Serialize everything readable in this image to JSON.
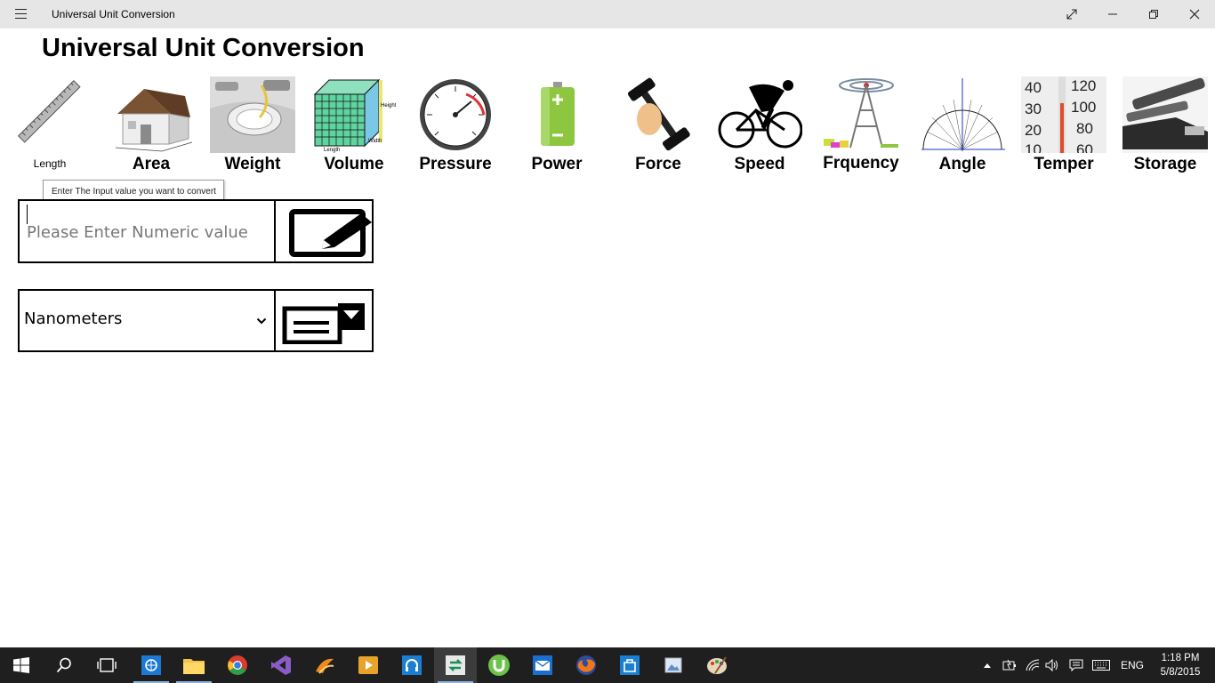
{
  "window": {
    "title": "Universal Unit Conversion",
    "menu_icon": "hamburger-menu-icon",
    "controls": [
      "fullscreen-icon",
      "minimize-icon",
      "restore-icon",
      "close-icon"
    ]
  },
  "page": {
    "title": "Universal Unit Conversion"
  },
  "categories": [
    {
      "label": "Length",
      "icon": "ruler-icon"
    },
    {
      "label": "Area",
      "icon": "house-icon"
    },
    {
      "label": "Weight",
      "icon": "scale-icon"
    },
    {
      "label": "Volume",
      "icon": "grid-cube-icon"
    },
    {
      "label": "Pressure",
      "icon": "pressure-gauge-icon"
    },
    {
      "label": "Power",
      "icon": "battery-icon"
    },
    {
      "label": "Force",
      "icon": "dumbbell-icon"
    },
    {
      "label": "Speed",
      "icon": "cyclist-icon"
    },
    {
      "label": "Frquency",
      "icon": "radio-tower-icon"
    },
    {
      "label": "Angle",
      "icon": "protractor-icon"
    },
    {
      "label": "Temper",
      "icon": "thermometer-icon"
    },
    {
      "label": "Storage",
      "icon": "usb-drive-icon"
    }
  ],
  "input": {
    "tooltip": "Enter The Input value you want to convert",
    "placeholder": "Please Enter Numeric value",
    "value": "",
    "edit_button_icon": "edit-pencil-icon"
  },
  "unit_select": {
    "selected": "Nanometers",
    "button_icon": "dropdown-list-icon"
  },
  "taskbar": {
    "apps": [
      "start-icon",
      "search-icon",
      "task-view-icon",
      "internet-explorer-icon",
      "file-explorer-icon",
      "chrome-icon",
      "visual-studio-icon",
      "orange-app-icon",
      "video-app-icon",
      "music-app-icon",
      "unit-converter-icon",
      "utorrent-icon",
      "mail-icon",
      "firefox-icon",
      "store-icon",
      "photos-icon",
      "paint-icon"
    ],
    "language": "ENG",
    "time": "1:18 PM",
    "date": "5/8/2015"
  }
}
